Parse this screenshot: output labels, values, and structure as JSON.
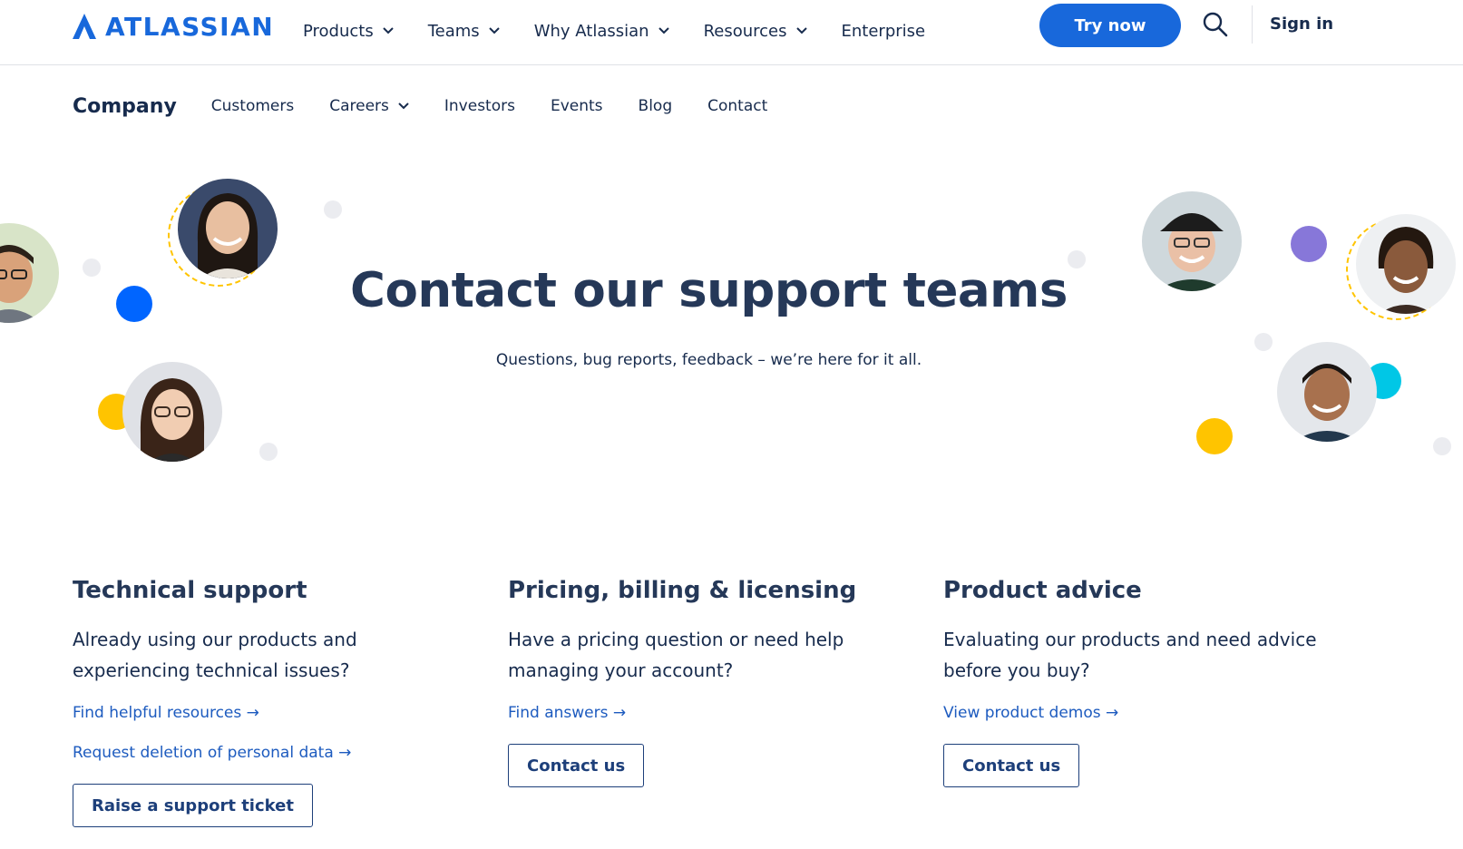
{
  "brand": {
    "name": "ATLASSIAN",
    "color": "#1868db"
  },
  "topnav": {
    "items": [
      {
        "label": "Products",
        "dropdown": true
      },
      {
        "label": "Teams",
        "dropdown": true
      },
      {
        "label": "Why Atlassian",
        "dropdown": true
      },
      {
        "label": "Resources",
        "dropdown": true
      },
      {
        "label": "Enterprise",
        "dropdown": false
      }
    ],
    "try_label": "Try now",
    "search_icon": "search-icon",
    "signin_label": "Sign in"
  },
  "subnav": {
    "title": "Company",
    "items": [
      {
        "label": "Customers",
        "dropdown": false
      },
      {
        "label": "Careers",
        "dropdown": true
      },
      {
        "label": "Investors",
        "dropdown": false
      },
      {
        "label": "Events",
        "dropdown": false
      },
      {
        "label": "Blog",
        "dropdown": false
      },
      {
        "label": "Contact",
        "dropdown": false
      }
    ]
  },
  "hero": {
    "title": "Contact our support teams",
    "subtitle": "Questions, bug reports, feedback – we’re here for it all."
  },
  "columns": [
    {
      "title": "Technical support",
      "description": "Already using our products and experiencing technical issues?",
      "links": [
        "Find helpful resources →",
        "Request deletion of personal data →"
      ],
      "button": "Raise a support ticket"
    },
    {
      "title": "Pricing, billing & licensing",
      "description": "Have a pricing question or need help managing your account?",
      "links": [
        "Find answers →"
      ],
      "button": "Contact us"
    },
    {
      "title": "Product advice",
      "description": "Evaluating our products and need advice before you buy?",
      "links": [
        "View product demos →"
      ],
      "button": "Contact us"
    }
  ],
  "colors": {
    "primary": "#1868db",
    "heading": "#253858",
    "link": "#1d5bbf",
    "deco_blue": "#0065ff",
    "deco_yellow": "#ffc400",
    "deco_purple": "#8777d9",
    "deco_cyan": "#00c7e6",
    "deco_grey": "#ebecf0"
  }
}
